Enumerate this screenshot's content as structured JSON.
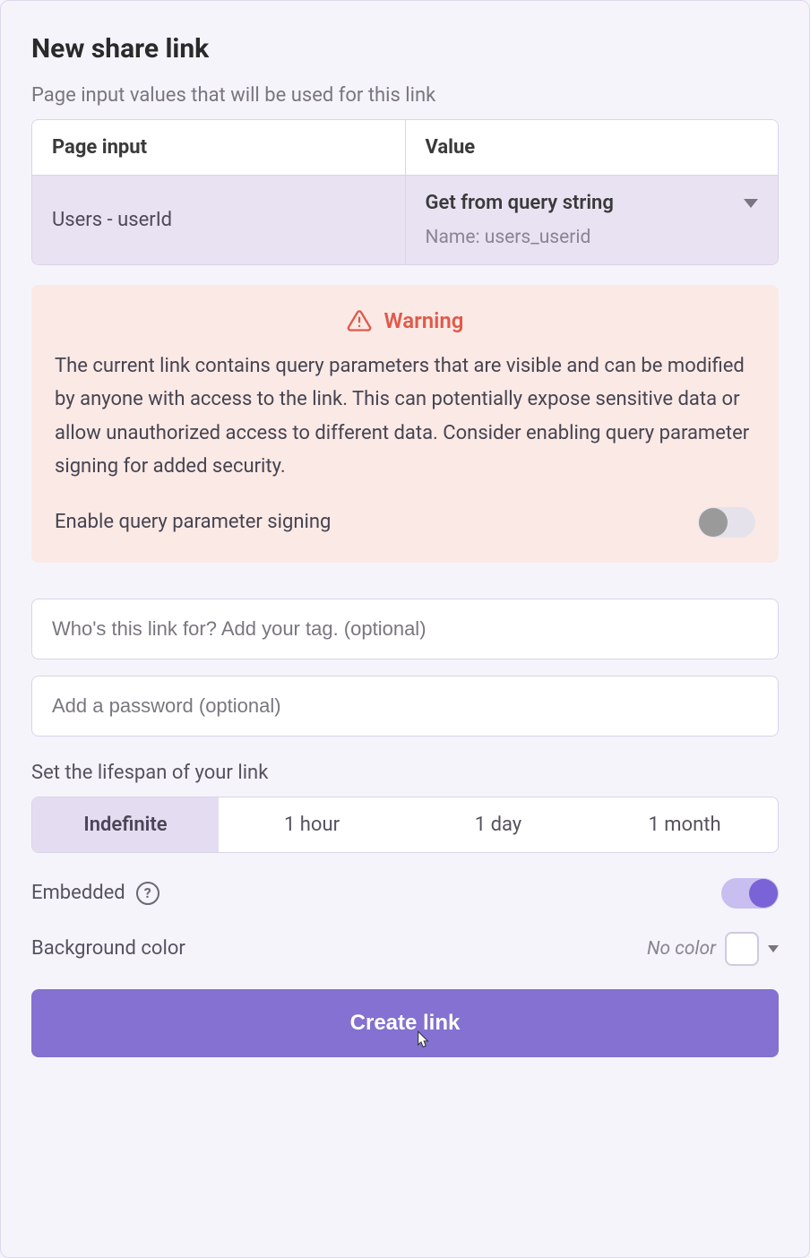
{
  "header": {
    "title": "New share link",
    "subtitle": "Page input values that will be used for this link"
  },
  "table": {
    "col_input": "Page input",
    "col_value": "Value",
    "row": {
      "input_name": "Users - userId",
      "value_select": "Get from query string",
      "param_label": "Name: users_userid"
    }
  },
  "warning": {
    "title": "Warning",
    "body": "The current link contains query parameters that are visible and can be modified by anyone with access to the link. This can potentially expose sensitive data or allow unauthorized access to different data. Consider enabling query parameter signing for added security.",
    "toggle_label": "Enable query parameter signing",
    "toggle_on": false
  },
  "inputs": {
    "tag_placeholder": "Who's this link for? Add your tag. (optional)",
    "password_placeholder": "Add a password (optional)"
  },
  "lifespan": {
    "label": "Set the lifespan of your link",
    "options": [
      "Indefinite",
      "1 hour",
      "1 day",
      "1 month"
    ],
    "active_index": 0
  },
  "embedded": {
    "label": "Embedded",
    "toggle_on": true
  },
  "bgcolor": {
    "label": "Background color",
    "value_text": "No color"
  },
  "actions": {
    "create": "Create link"
  }
}
